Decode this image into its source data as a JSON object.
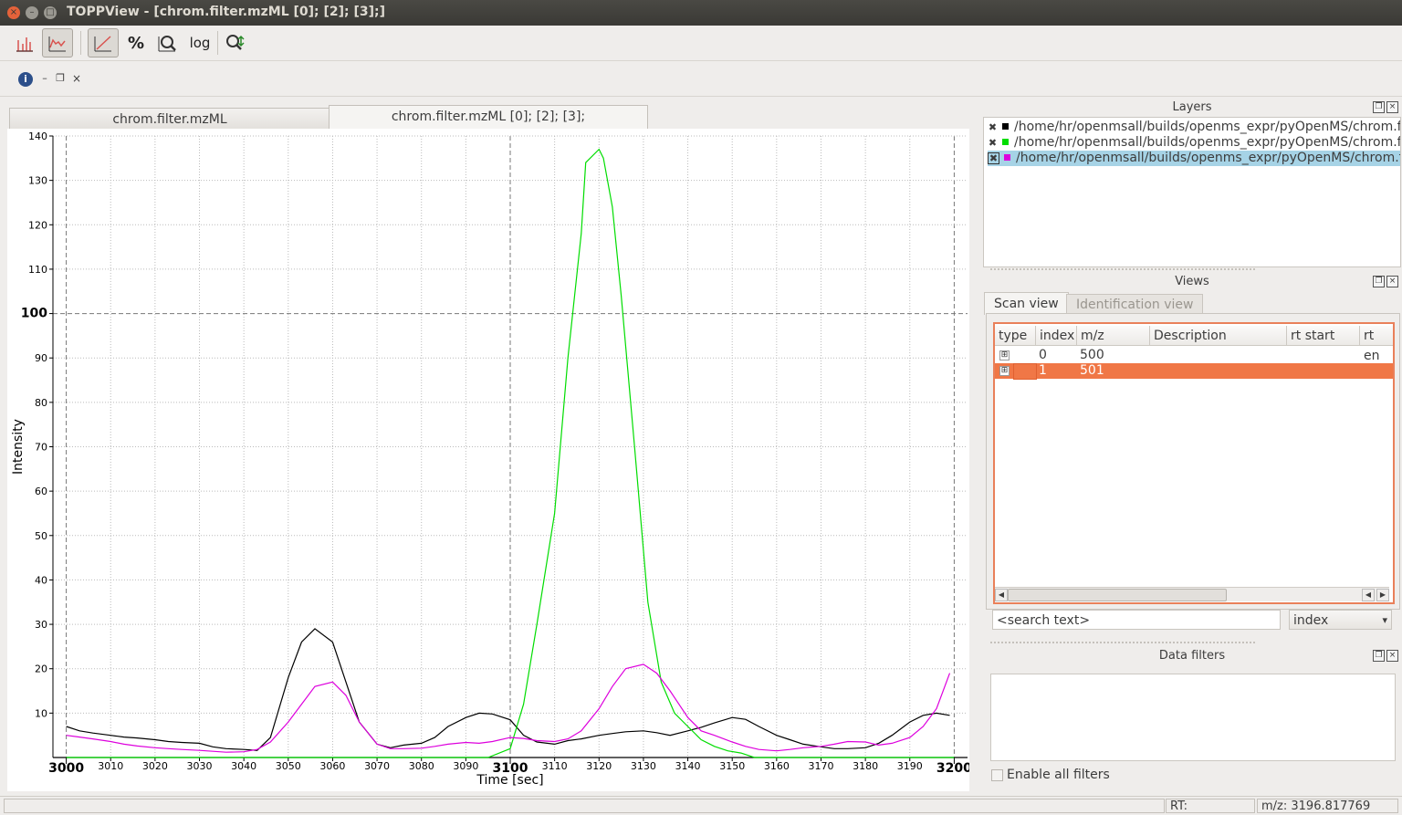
{
  "window": {
    "title": "TOPPView - [chrom.filter.mzML [0]; [2]; [3];]",
    "close_glyph": "×",
    "min_glyph": "–",
    "max_glyph": "□"
  },
  "toolbar": {
    "buttons": [
      {
        "icon": "bar-spectrum-icon",
        "label": "",
        "active": false
      },
      {
        "icon": "line-spectrum-icon",
        "label": "",
        "active": true
      },
      {
        "icon": "linear-intensity-icon",
        "label": "",
        "active": true
      },
      {
        "icon": "percentage-icon",
        "label": "%",
        "active": false
      },
      {
        "icon": "zoom-icon",
        "label": "",
        "active": false
      },
      {
        "icon": "log-icon",
        "label": "log",
        "active": false
      },
      {
        "icon": "snap-icon",
        "label": "",
        "active": false
      }
    ]
  },
  "toolbar2": {
    "info_glyph": "i",
    "min_glyph": "–",
    "restore_glyph": "❐",
    "close_glyph": "×"
  },
  "tabs": [
    {
      "label": "chrom.filter.mzML",
      "active": false
    },
    {
      "label": "chrom.filter.mzML [0]; [2]; [3];",
      "active": true
    }
  ],
  "chart_data": {
    "type": "line",
    "xlabel": "Time [sec]",
    "ylabel": "Intensity",
    "xlim": [
      2997,
      3203
    ],
    "ylim": [
      0,
      140
    ],
    "x_ticks_major": [
      3000,
      3100,
      3200
    ],
    "x_ticks_minor": [
      3010,
      3020,
      3030,
      3040,
      3050,
      3060,
      3070,
      3080,
      3090,
      3110,
      3120,
      3130,
      3140,
      3150,
      3160,
      3170,
      3180,
      3190
    ],
    "y_ticks": [
      10,
      20,
      30,
      40,
      50,
      60,
      70,
      80,
      90,
      100,
      110,
      120,
      130,
      140
    ],
    "y_major": 100,
    "grid": true,
    "series": [
      {
        "color": "#000000",
        "x": [
          3000,
          3003,
          3006,
          3010,
          3013,
          3016,
          3020,
          3023,
          3026,
          3030,
          3033,
          3036,
          3040,
          3043,
          3046,
          3050,
          3053,
          3056,
          3060,
          3063,
          3066,
          3070,
          3073,
          3076,
          3080,
          3083,
          3086,
          3090,
          3093,
          3096,
          3100,
          3103,
          3106,
          3110,
          3113,
          3116,
          3120,
          3123,
          3126,
          3130,
          3133,
          3136,
          3140,
          3143,
          3146,
          3150,
          3153,
          3156,
          3160,
          3163,
          3166,
          3170,
          3173,
          3176,
          3180,
          3183,
          3186,
          3190,
          3193,
          3196,
          3199
        ],
        "y": [
          7,
          6,
          5.5,
          5,
          4.6,
          4.4,
          4,
          3.6,
          3.4,
          3.2,
          2.4,
          2,
          1.8,
          1.6,
          4.5,
          18,
          26,
          29,
          26,
          17,
          8,
          3,
          2.2,
          2.8,
          3.2,
          4.5,
          7,
          9,
          10,
          9.8,
          8.5,
          5,
          3.5,
          3,
          3.8,
          4.2,
          5,
          5.4,
          5.8,
          6,
          5.6,
          5,
          6,
          6.8,
          7.8,
          9,
          8.6,
          7,
          5,
          4,
          3,
          2.4,
          2,
          2,
          2.2,
          3.2,
          5,
          8,
          9.5,
          10,
          9.5
        ]
      },
      {
        "color": "#00dd00",
        "x": [
          3000,
          3050,
          3070,
          3080,
          3090,
          3095,
          3100,
          3103,
          3106,
          3110,
          3113,
          3116,
          3117,
          3120,
          3121,
          3123,
          3125,
          3128,
          3131,
          3134,
          3137,
          3140,
          3143,
          3146,
          3149,
          3152,
          3155,
          3158,
          3165,
          3175,
          3190,
          3200
        ],
        "y": [
          0,
          0,
          0,
          0,
          0,
          0,
          2,
          12,
          30,
          55,
          90,
          118,
          134,
          137,
          135,
          124,
          104,
          70,
          35,
          17,
          10,
          7,
          4,
          2.5,
          1.5,
          1,
          0,
          0,
          0,
          0,
          0,
          0
        ]
      },
      {
        "color": "#dd00dd",
        "x": [
          3000,
          3003,
          3006,
          3010,
          3013,
          3016,
          3020,
          3023,
          3026,
          3030,
          3033,
          3036,
          3040,
          3043,
          3046,
          3050,
          3053,
          3056,
          3060,
          3063,
          3066,
          3070,
          3073,
          3076,
          3080,
          3083,
          3086,
          3090,
          3093,
          3096,
          3100,
          3103,
          3106,
          3110,
          3113,
          3116,
          3120,
          3123,
          3126,
          3130,
          3133,
          3136,
          3140,
          3143,
          3146,
          3150,
          3153,
          3156,
          3160,
          3163,
          3166,
          3170,
          3173,
          3176,
          3180,
          3183,
          3186,
          3190,
          3193,
          3196,
          3199
        ],
        "y": [
          5,
          4.6,
          4.2,
          3.6,
          3,
          2.6,
          2.2,
          2,
          1.8,
          1.6,
          1.4,
          1.2,
          1.3,
          1.8,
          3.5,
          8,
          12,
          16,
          17,
          14,
          8,
          3,
          2,
          2,
          2.1,
          2.5,
          3,
          3.4,
          3.2,
          3.6,
          4.5,
          4.3,
          3.8,
          3.6,
          4.2,
          6,
          11,
          16,
          20,
          21,
          19,
          15,
          9,
          6,
          5,
          3.5,
          2.5,
          1.8,
          1.5,
          1.8,
          2.2,
          2.5,
          3,
          3.6,
          3.5,
          2.8,
          3.2,
          4.5,
          7,
          11,
          19
        ]
      }
    ]
  },
  "layers": {
    "title": "Layers",
    "rows": [
      {
        "color": "#000000",
        "path": "/home/hr/openmsall/builds/openms_expr/pyOpenMS/chrom.filter.mzML",
        "selected": false
      },
      {
        "color": "#00dd00",
        "path": "/home/hr/openmsall/builds/openms_expr/pyOpenMS/chrom.filter.mzML",
        "selected": false
      },
      {
        "color": "#dd00dd",
        "path": "/home/hr/openmsall/builds/openms_expr/pyOpenMS/chrom.filter.mzML",
        "selected": true
      }
    ]
  },
  "views": {
    "title": "Views",
    "tabs": [
      "Scan view",
      "Identification view"
    ],
    "columns": [
      "type",
      "index",
      "m/z",
      "Description",
      "rt start",
      "rt en"
    ],
    "rows": [
      {
        "expander": "⊞",
        "index": "0",
        "mz": "500",
        "selected": false
      },
      {
        "expander": "⊞",
        "index": "1",
        "mz": "501",
        "selected": true
      }
    ],
    "search_placeholder": "<search text>",
    "search_field": "index"
  },
  "data_filters": {
    "title": "Data filters",
    "enable_label": "Enable all filters"
  },
  "dock_buttons": {
    "float_glyph": "❐",
    "close_glyph": "×"
  },
  "scroll_glyphs": {
    "left": "◀",
    "right": "▶",
    "dropdown": "▾"
  },
  "status": {
    "rt_label": "RT:",
    "mz_label": "m/z: 3196.817769"
  }
}
